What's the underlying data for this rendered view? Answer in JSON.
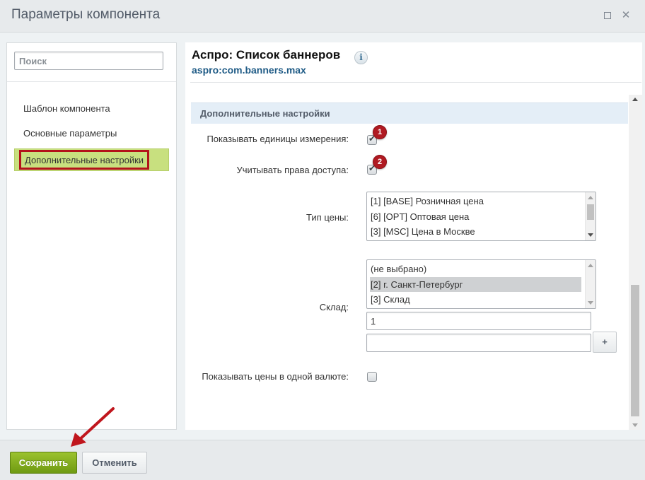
{
  "dialog": {
    "title": "Параметры компонента"
  },
  "sidebar": {
    "search_placeholder": "Поиск",
    "items": [
      {
        "label": "Шаблон компонента"
      },
      {
        "label": "Основные параметры"
      },
      {
        "label": "Дополнительные настройки",
        "active": true
      }
    ]
  },
  "component": {
    "title": "Аспро: Список баннеров",
    "code": "aspro:com.banners.max",
    "info_glyph": "i"
  },
  "section": {
    "title": "Дополнительные настройки",
    "fields": {
      "show_units": {
        "label": "Показывать единицы измерения:",
        "checked": true,
        "badge": "1"
      },
      "access_rights": {
        "label": "Учитывать права доступа:",
        "checked": true,
        "badge": "2"
      },
      "price_type": {
        "label": "Тип цены:",
        "options": [
          "[1] [BASE] Розничная цена",
          "[6] [OPT] Оптовая цена",
          "[3] [MSC] Цена в Москве"
        ]
      },
      "warehouse": {
        "label": "Склад:",
        "options": [
          "(не выбрано)",
          "[2] г. Санкт-Петербург",
          "[3] Склад"
        ],
        "selected_option": "[2] г. Санкт-Петербург",
        "extra_value": "1",
        "extra_empty_value": "",
        "add_label": "+"
      },
      "single_currency": {
        "label": "Показывать цены в одной валюте:",
        "checked": false
      }
    }
  },
  "footer": {
    "save_label": "Сохранить",
    "cancel_label": "Отменить"
  },
  "colors": {
    "save_button": "#7eaa18",
    "highlight_border": "#b3121a",
    "active_item_bg": "#c8e07f",
    "badge": "#b01a22",
    "annotation_arrow": "#c0161d"
  }
}
